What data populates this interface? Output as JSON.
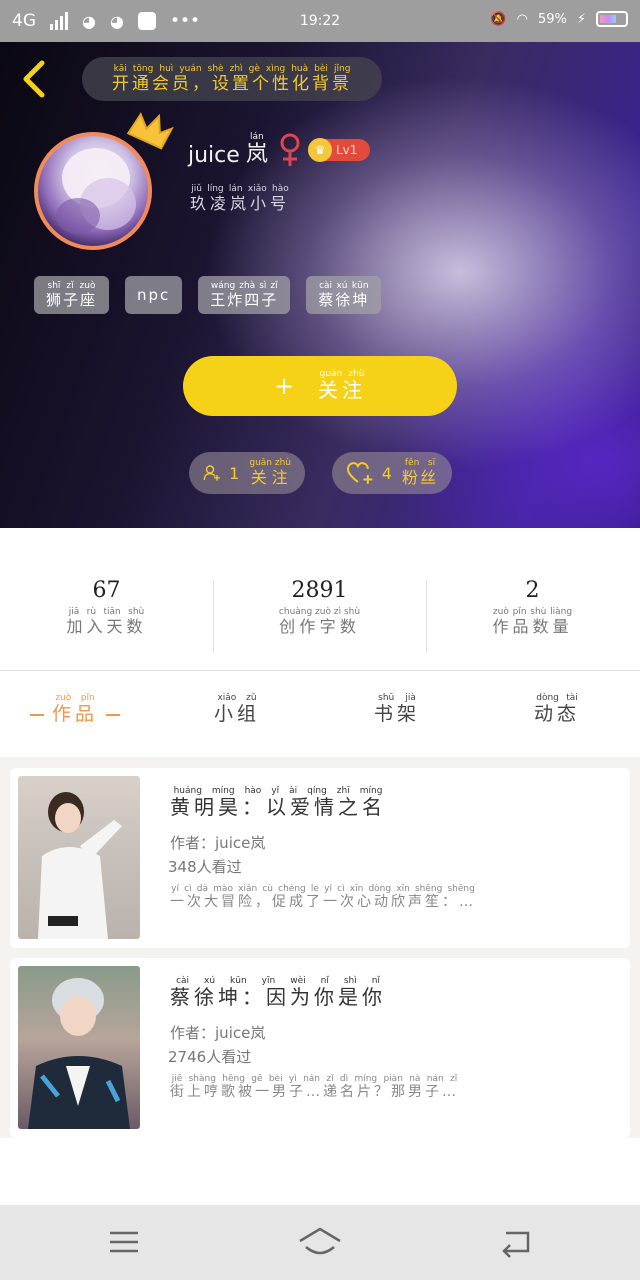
{
  "status_bar": {
    "network": "4G",
    "time": "19:22",
    "battery": "59%"
  },
  "header": {
    "vip_text": "开通会员，设置个性化背景",
    "vip_pinyin": "kāi tōng huì yuán shè zhì gè xìng huà bèi jǐng",
    "username": "juice",
    "username_suffix": "岚",
    "username_suffix_pinyin": "lán",
    "level": "Lv1",
    "subname": "玖凌岚小号",
    "subname_pinyin": "jiǔ líng lán xiǎo hào",
    "tags": [
      "狮子座",
      "npc",
      "王炸四子",
      "蔡徐坤"
    ],
    "tags_pinyin": [
      "shī zǐ zuò",
      "",
      "wáng zhà sì zǐ",
      "cài xú kūn"
    ],
    "follow_label": "关注",
    "follow_pinyin": "guān zhù",
    "following_count": "1",
    "following_label": "关注",
    "fans_count": "4",
    "fans_label": "粉丝",
    "fans_pinyin": "fěn sī"
  },
  "stats": [
    {
      "value": "67",
      "label": "加入天数",
      "pinyin": "jiā rù tiān shù"
    },
    {
      "value": "2891",
      "label": "创作字数",
      "pinyin": "chuàng zuò zì shù"
    },
    {
      "value": "2",
      "label": "作品数量",
      "pinyin": "zuò pǐn shù liàng"
    }
  ],
  "tabs": [
    {
      "label": "作品",
      "pinyin": "zuò pǐn"
    },
    {
      "label": "小组",
      "pinyin": "xiǎo zǔ"
    },
    {
      "label": "书架",
      "pinyin": "shū jià"
    },
    {
      "label": "动态",
      "pinyin": "dòng tài"
    }
  ],
  "works": [
    {
      "title": "黄明昊：以爱情之名",
      "title_pinyin": "huáng míng hào yǐ ài qíng zhī míng",
      "author_label": "作者：",
      "author": "juice岚",
      "views": "348",
      "views_label": "人看过",
      "desc": "一次大冒险，促成了一次心动欣声笙：…",
      "desc_pinyin": "yí cì dà mào xiǎn cù chéng le yí cì xīn dòng xīn shēng shēng"
    },
    {
      "title": "蔡徐坤：因为你是你",
      "title_pinyin": "cài xú kūn yīn wèi nǐ shì nǐ",
      "author_label": "作者：",
      "author": "juice岚",
      "views": "2746",
      "views_label": "人看过",
      "desc": "街上哼歌被一男子…递名片？那男子…",
      "desc_pinyin": "jiē shàng hēng gē bèi yì nán zǐ dì míng piàn nà nán zǐ"
    }
  ],
  "colors": {
    "accent": "#f5d218",
    "tab_active": "#f0974a",
    "gold_text": "#f5cb2a"
  }
}
